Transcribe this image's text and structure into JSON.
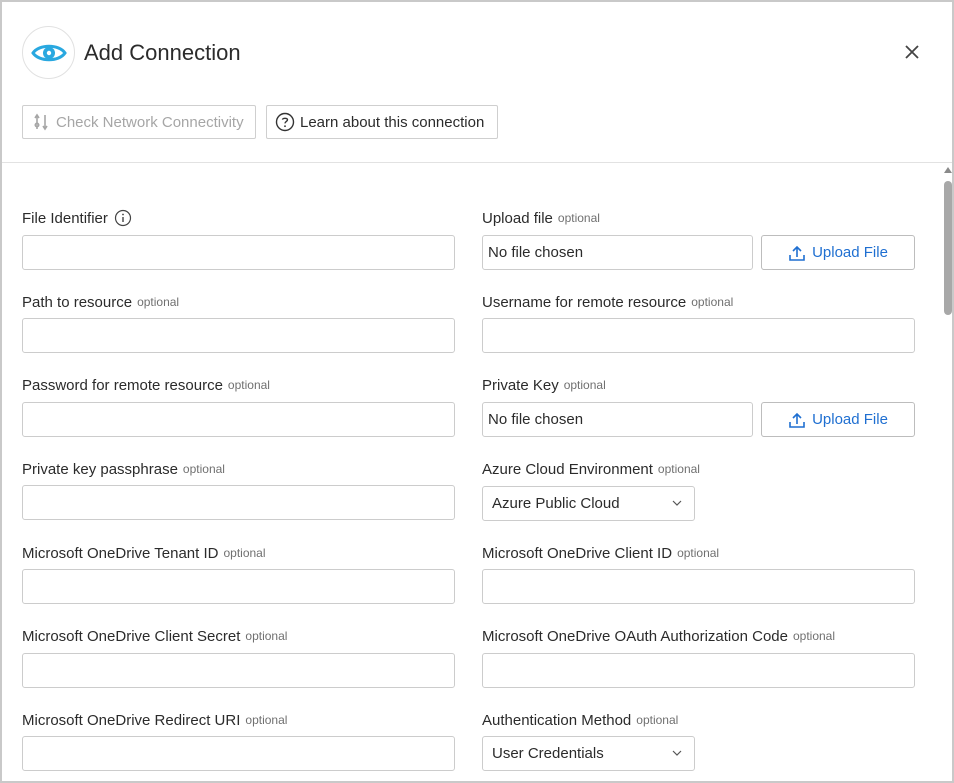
{
  "dialog": {
    "title": "Add Connection",
    "logo_icon": "eye-icon",
    "close_icon": "close-icon",
    "accent_color": "#1f6fd1",
    "logo_color": "#29a8e0"
  },
  "toolbar": {
    "check_network_label": "Check Network Connectivity",
    "check_network_icon": "network-check-icon",
    "learn_label": "Learn about this connection",
    "learn_icon": "question-circle-icon"
  },
  "form": {
    "file_identifier": {
      "label": "File Identifier",
      "value": ""
    },
    "upload_file": {
      "label": "Upload file",
      "optional": "optional",
      "file_status": "No file chosen",
      "button_label": "Upload File"
    },
    "path_to_resource": {
      "label": "Path to resource",
      "optional": "optional",
      "value": ""
    },
    "username_remote": {
      "label": "Username for remote resource",
      "optional": "optional",
      "value": ""
    },
    "password_remote": {
      "label": "Password for remote resource",
      "optional": "optional",
      "value": ""
    },
    "private_key": {
      "label": "Private Key",
      "optional": "optional",
      "file_status": "No file chosen",
      "button_label": "Upload File"
    },
    "private_key_passphrase": {
      "label": "Private key passphrase",
      "optional": "optional",
      "value": ""
    },
    "azure_cloud_env": {
      "label": "Azure Cloud Environment",
      "optional": "optional",
      "selected": "Azure Public Cloud"
    },
    "onedrive_tenant_id": {
      "label": "Microsoft OneDrive Tenant ID",
      "optional": "optional",
      "value": ""
    },
    "onedrive_client_id": {
      "label": "Microsoft OneDrive Client ID",
      "optional": "optional",
      "value": ""
    },
    "onedrive_client_secret": {
      "label": "Microsoft OneDrive Client Secret",
      "optional": "optional",
      "value": ""
    },
    "onedrive_oauth_code": {
      "label": "Microsoft OneDrive OAuth Authorization Code",
      "optional": "optional",
      "value": ""
    },
    "onedrive_redirect_uri": {
      "label": "Microsoft OneDrive Redirect URI",
      "optional": "optional",
      "value": ""
    },
    "auth_method": {
      "label": "Authentication Method",
      "optional": "optional",
      "selected": "User Credentials"
    }
  }
}
